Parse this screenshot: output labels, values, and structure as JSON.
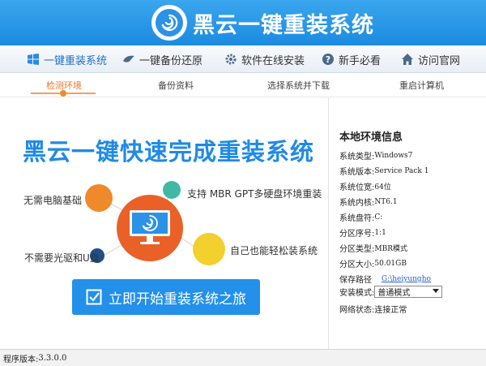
{
  "header": {
    "title": "黑云一键重装系统"
  },
  "nav": {
    "items": [
      {
        "label": "一键重装系统",
        "icon": "windows-icon"
      },
      {
        "label": "一键备份还原",
        "icon": "bird-icon"
      },
      {
        "label": "软件在线安装",
        "icon": "gear-icon"
      },
      {
        "label": "新手必看",
        "icon": "question-icon"
      },
      {
        "label": "访问官网",
        "icon": "home-icon"
      }
    ]
  },
  "steps": [
    {
      "label": "检测环境"
    },
    {
      "label": "备份资料"
    },
    {
      "label": "选择系统并下载"
    },
    {
      "label": "重启计算机"
    }
  ],
  "main": {
    "headline": "黑云一键快速完成重装系统",
    "features": [
      "无需电脑基础",
      "支持 MBR GPT多硬盘环境重装",
      "不需要光驱和U盘",
      "自己也能轻松装系统"
    ],
    "start_button": "立即开始重装系统之旅"
  },
  "panel": {
    "title": "本地环境信息",
    "rows": [
      {
        "label": "系统类型:",
        "value": "Windows7"
      },
      {
        "label": "系统版本:",
        "value": "Service Pack 1"
      },
      {
        "label": "系统位宽:",
        "value": "64位"
      },
      {
        "label": "系统内核:",
        "value": "NT6.1"
      },
      {
        "label": "系统盘符:",
        "value": "C:"
      },
      {
        "label": "分区序号:",
        "value": "1:1"
      },
      {
        "label": "分区类型:",
        "value": "MBR模式"
      },
      {
        "label": "分区大小:",
        "value": "50.01GB"
      }
    ],
    "save_path_label": "保存路径",
    "save_path_value": "G:\\heiyungho",
    "install_mode_label": "安装模式:",
    "install_mode_value": "普通模式",
    "network_label": "网络状态:",
    "network_value": "连接正常"
  },
  "footer": {
    "version_label": "程序版本:",
    "version_value": "3.3.0.0"
  },
  "colors": {
    "primary": "#2390ea",
    "accent_orange": "#e8782b",
    "teal": "#3fb9a6",
    "yellow": "#f2d02e",
    "navy": "#1f4f8a"
  }
}
